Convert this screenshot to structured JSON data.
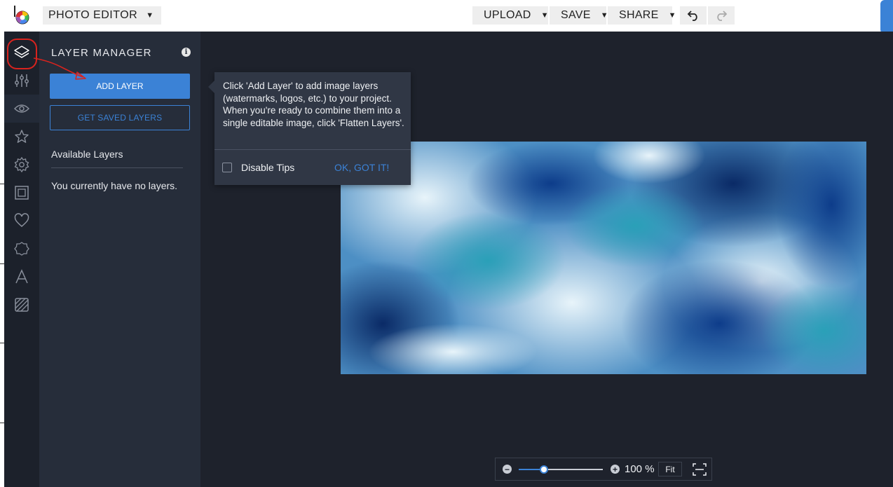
{
  "topbar": {
    "app_label": "PHOTO EDITOR",
    "upload_label": "UPLOAD",
    "save_label": "SAVE",
    "share_label": "SHARE",
    "caret": "▼"
  },
  "rail": {
    "items": [
      "layers-icon",
      "adjustments-icon",
      "eye-icon",
      "star-icon",
      "badge-icon",
      "frame-icon",
      "heart-icon",
      "sticker-icon",
      "text-icon",
      "texture-icon"
    ]
  },
  "panel": {
    "title": "LAYER MANAGER",
    "info": "i",
    "add_layer_label": "ADD LAYER",
    "saved_layers_label": "GET SAVED LAYERS",
    "available_title": "Available Layers",
    "empty_message": "You currently have no layers."
  },
  "tooltip": {
    "text": "Click 'Add Layer' to add image layers (watermarks, logos, etc.) to your project. When you're ready to combine them into a single editable image, click 'Flatten Layers'.",
    "checkbox_label": "Disable Tips",
    "ok_label": "OK, GOT IT!"
  },
  "zoom": {
    "minus": "−",
    "plus": "+",
    "value_text": "100 %",
    "fit_label": "Fit",
    "level": 0.3
  },
  "colors": {
    "accent": "#3b82d6",
    "rail": "#1c212b",
    "panel": "#262d3a",
    "canvas": "#1e222c",
    "annotation": "#d8231e"
  }
}
